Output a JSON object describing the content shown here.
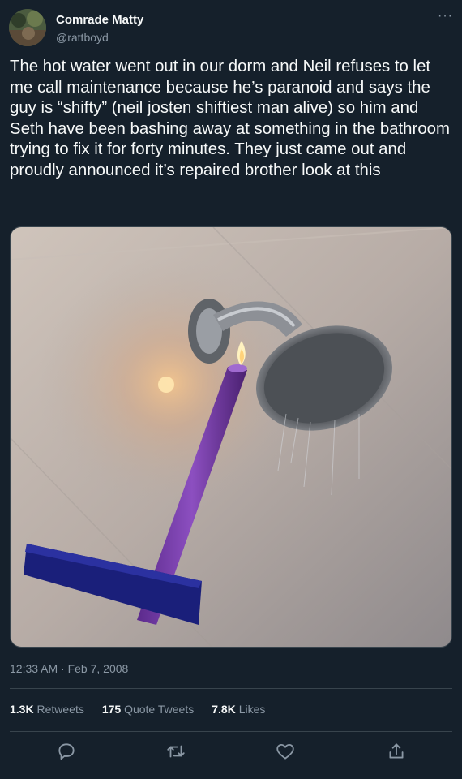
{
  "user": {
    "name": "Comrade Matty",
    "handle": "@rattboyd"
  },
  "tweet": {
    "text": "The hot water went out in our dorm and Neil refuses to let me call maintenance because he’s paranoid and says the guy is “shifty” (neil josten shiftiest man alive) so him and Seth have been bashing away at something in the bathroom trying to fix it for forty minutes. They just came out and proudly announced it’s repaired brother look at this",
    "timestamp": "12:33 AM · Feb 7, 2008"
  },
  "stats": {
    "retweets_count": "1.3K",
    "retweets_label": "Retweets",
    "quotes_count": "175",
    "quotes_label": "Quote Tweets",
    "likes_count": "7.8K",
    "likes_label": "Likes"
  },
  "icons": {
    "more": "more-options-icon",
    "reply": "reply-icon",
    "retweet": "retweet-icon",
    "like": "heart-icon",
    "share": "share-icon"
  },
  "colors": {
    "background": "#15202b",
    "text": "#f7f9f9",
    "muted": "#8b98a5",
    "border": "#38444d"
  }
}
